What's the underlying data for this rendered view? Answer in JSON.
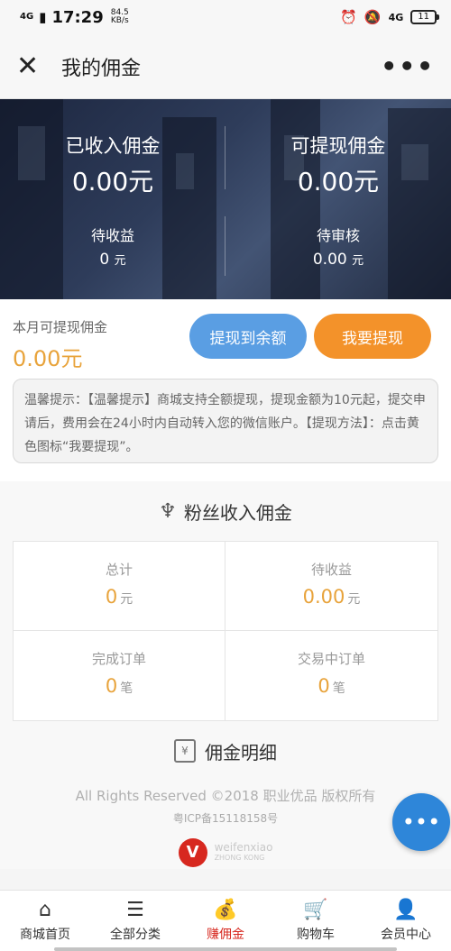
{
  "status_bar": {
    "network": "4G",
    "time": "17:29",
    "speed_value": "84.5",
    "speed_unit": "KB/s",
    "network_right": "4G",
    "battery": "11"
  },
  "header": {
    "title": "我的佣金"
  },
  "hero": {
    "received_label": "已收入佣金",
    "received_value": "0.00元",
    "withdrawable_label": "可提现佣金",
    "withdrawable_value": "0.00元",
    "pending_income_label": "待收益",
    "pending_income_value": "0",
    "pending_income_unit": "元",
    "pending_review_label": "待审核",
    "pending_review_value": "0.00",
    "pending_review_unit": "元"
  },
  "withdraw": {
    "month_label": "本月可提现佣金",
    "month_value": "0.00元",
    "to_balance_label": "提现到余额",
    "withdraw_label": "我要提现"
  },
  "notice": {
    "text": "温馨提示：【温馨提示】商城支持全额提现，提现金额为10元起，提交申请后，费用会在24小时内自动转入您的微信账户。【提现方法】：点击黄色图标“我要提现”。"
  },
  "fans": {
    "title": "粉丝收入佣金",
    "cells": [
      {
        "label": "总计",
        "value": "0",
        "unit": "元"
      },
      {
        "label": "待收益",
        "value": "0.00",
        "unit": "元"
      },
      {
        "label": "完成订单",
        "value": "0",
        "unit": "笔"
      },
      {
        "label": "交易中订单",
        "value": "0",
        "unit": "笔"
      }
    ]
  },
  "detail": {
    "title": "佣金明细"
  },
  "footer": {
    "copyright": "All Rights Reserved ©2018 职业优品 版权所有",
    "icp": "粤ICP备15118158号",
    "logo_text_1": "weifenxiao",
    "logo_text_2": "ZHONG KONG"
  },
  "tabbar": {
    "items": [
      {
        "label": "商城首页",
        "icon": "home-icon"
      },
      {
        "label": "全部分类",
        "icon": "list-icon"
      },
      {
        "label": "赚佣金",
        "icon": "money-bag-icon"
      },
      {
        "label": "购物车",
        "icon": "cart-icon"
      },
      {
        "label": "会员中心",
        "icon": "user-icon"
      }
    ],
    "active": 2
  },
  "colors": {
    "accent_gold": "#e8a33b",
    "button_blue": "#5a9ee3",
    "button_orange": "#f3922a",
    "active_tab": "#d7281f",
    "fab_blue": "#2e86d9"
  }
}
